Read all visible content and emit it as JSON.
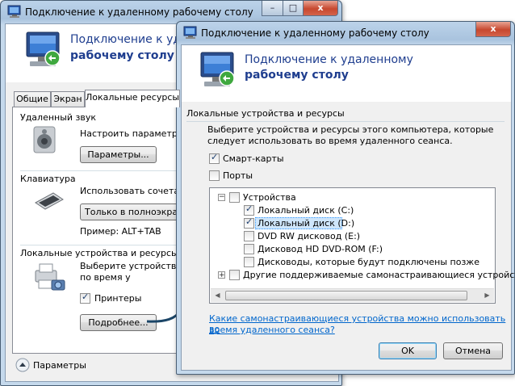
{
  "back_window": {
    "title": "Подключение к удаленному рабочему столу",
    "header_line1": "Подключение к удал",
    "header_line2": "рабочему столу",
    "controls": {
      "minimize": "–",
      "maximize": "□",
      "close": "x"
    },
    "tabs": [
      "Общие",
      "Экран",
      "Локальные ресурсы"
    ],
    "sound": {
      "title": "Удаленный звук",
      "text": "Настроить параметры уд",
      "button": "Параметры..."
    },
    "keyboard": {
      "title": "Клавиатура",
      "text": "Использовать сочетания",
      "dropdown_value": "Только в полноэкранном",
      "example": "Пример: ALT+TAB"
    },
    "local": {
      "title": "Локальные устройства и ресурсы",
      "text_line1": "Выберите устройства и р",
      "text_line2": "по время у",
      "printers_label": "Принтеры",
      "printers_checked": true,
      "button": "Подробнее..."
    },
    "footer_options": "Параметры"
  },
  "front_window": {
    "title": "Подключение к удаленному рабочему столу",
    "header_line1": "Подключение к удаленному",
    "header_line2": "рабочему столу",
    "controls": {
      "close": "x"
    },
    "section_title": "Локальные устройства и ресурсы",
    "description_line1": "Выберите устройства и ресурсы этого компьютера, которые",
    "description_line2": "следует использовать во время удаленного сеанса.",
    "smart_cards": {
      "label": "Смарт-карты",
      "checked": true
    },
    "ports": {
      "label": "Порты",
      "checked": false
    },
    "tree": {
      "root": {
        "expander": "−",
        "label": "Устройства",
        "checked": false
      },
      "items": [
        {
          "label": "Локальный диск (C:)",
          "checked": true
        },
        {
          "label": "Локальный диск (D:)",
          "checked": true
        },
        {
          "label": "DVD RW дисковод (E:)",
          "checked": false
        },
        {
          "label": "Дисковод HD DVD-ROM (F:)",
          "checked": false
        },
        {
          "label": "Дисководы, которые будут подключены позже",
          "checked": false
        }
      ],
      "other": {
        "expander": "+",
        "label": "Другие поддерживаемые самонастраивающиеся устройства",
        "checked": false
      }
    },
    "link_line1": "Какие самонастраивающиеся устройства можно использовать во",
    "link_line2": "время удаленного сеанса?",
    "ok_button": "OK",
    "cancel_button": "Отмена"
  },
  "colors": {
    "header_text": "#1f3e8f",
    "link": "#0066cc",
    "arrow": "#1b4567",
    "selection": "#cfe6fb"
  }
}
